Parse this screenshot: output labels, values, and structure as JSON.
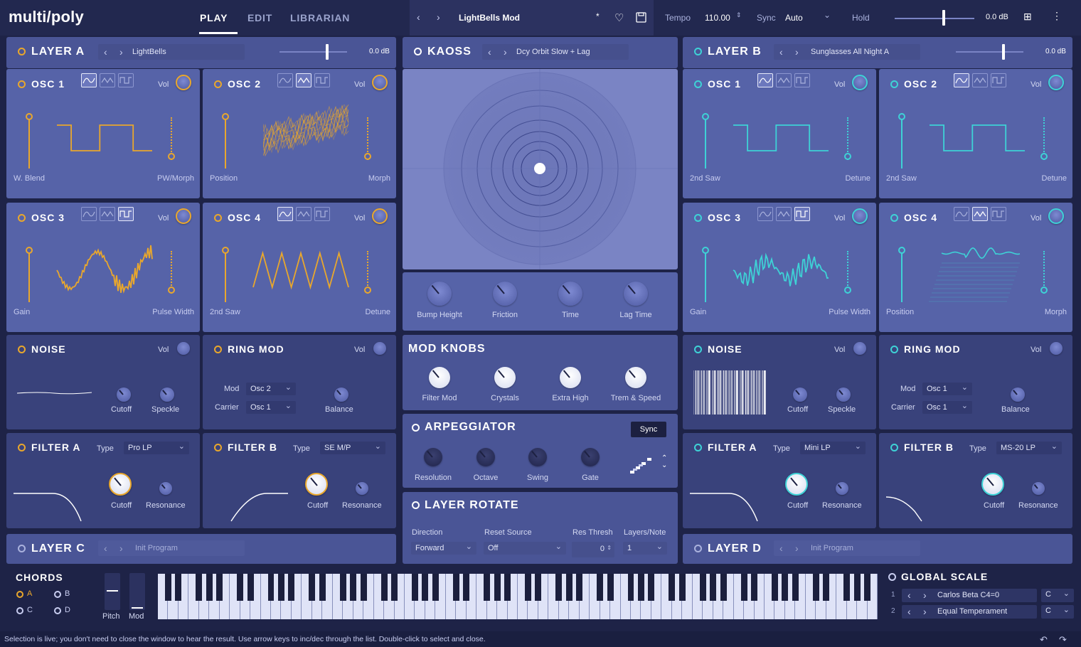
{
  "header": {
    "logo": "multi/poly",
    "tabs": [
      "PLAY",
      "EDIT",
      "LIBRARIAN"
    ],
    "preset_name": "LightBells Mod",
    "modified_mark": "*",
    "tempo_label": "Tempo",
    "tempo_value": "110.00",
    "sync_label": "Sync",
    "sync_value": "Auto",
    "hold_label": "Hold",
    "volume_db": "0.0 dB"
  },
  "layers": {
    "a": {
      "title": "LAYER A",
      "preset": "LightBells",
      "db": "0.0 dB"
    },
    "b": {
      "title": "LAYER B",
      "preset": "Sunglasses All Night A",
      "db": "0.0 dB"
    },
    "c": {
      "title": "LAYER C",
      "preset": "Init Program"
    },
    "d": {
      "title": "LAYER D",
      "preset": "Init Program"
    }
  },
  "osc": {
    "a1": {
      "title": "OSC 1",
      "vol": "Vol",
      "left": "W. Blend",
      "right": "PW/Morph"
    },
    "a2": {
      "title": "OSC 2",
      "vol": "Vol",
      "left": "Position",
      "right": "Morph"
    },
    "a3": {
      "title": "OSC 3",
      "vol": "Vol",
      "left": "Gain",
      "right": "Pulse Width"
    },
    "a4": {
      "title": "OSC 4",
      "vol": "Vol",
      "left": "2nd Saw",
      "right": "Detune"
    },
    "b1": {
      "title": "OSC 1",
      "vol": "Vol",
      "left": "2nd Saw",
      "right": "Detune"
    },
    "b2": {
      "title": "OSC 2",
      "vol": "Vol",
      "left": "2nd Saw",
      "right": "Detune"
    },
    "b3": {
      "title": "OSC 3",
      "vol": "Vol",
      "left": "Gain",
      "right": "Pulse Width"
    },
    "b4": {
      "title": "OSC 4",
      "vol": "Vol",
      "left": "Position",
      "right": "Morph"
    }
  },
  "noise": {
    "title": "NOISE",
    "vol": "Vol",
    "cutoff": "Cutoff",
    "speckle": "Speckle"
  },
  "ringmod": {
    "title": "RING MOD",
    "vol": "Vol",
    "mod_label": "Mod",
    "mod_value": "Osc 2",
    "carrier_label": "Carrier",
    "carrier_value": "Osc 1",
    "balance": "Balance"
  },
  "ringmod_b": {
    "mod_value": "Osc 1",
    "carrier_value": "Osc 1"
  },
  "filters": {
    "aa": {
      "title": "FILTER A",
      "type_label": "Type",
      "type": "Pro LP",
      "cutoff": "Cutoff",
      "resonance": "Resonance"
    },
    "ab": {
      "title": "FILTER B",
      "type_label": "Type",
      "type": "SE M/P",
      "cutoff": "Cutoff",
      "resonance": "Resonance"
    },
    "ba": {
      "title": "FILTER A",
      "type_label": "Type",
      "type": "Mini LP",
      "cutoff": "Cutoff",
      "resonance": "Resonance"
    },
    "bb": {
      "title": "FILTER B",
      "type_label": "Type",
      "type": "MS-20 LP",
      "cutoff": "Cutoff",
      "resonance": "Resonance"
    }
  },
  "kaoss": {
    "title": "KAOSS",
    "preset": "Dcy Orbit Slow + Lag",
    "knobs": [
      "Bump Height",
      "Friction",
      "Time",
      "Lag Time"
    ]
  },
  "mod_knobs": {
    "title": "MOD KNOBS",
    "knobs": [
      "Filter Mod",
      "Crystals",
      "Extra High",
      "Trem & Speed"
    ]
  },
  "arp": {
    "title": "ARPEGGIATOR",
    "sync": "Sync",
    "knobs": [
      "Resolution",
      "Octave",
      "Swing",
      "Gate"
    ]
  },
  "rotate": {
    "title": "LAYER ROTATE",
    "direction_label": "Direction",
    "direction": "Forward",
    "reset_label": "Reset Source",
    "reset": "Off",
    "res_label": "Res Thresh",
    "res": "0",
    "layers_label": "Layers/Note",
    "layers": "1"
  },
  "chords": {
    "title": "CHORDS",
    "items": [
      "A",
      "B",
      "C",
      "D"
    ]
  },
  "wheels": {
    "pitch": "Pitch",
    "mod": "Mod"
  },
  "scale": {
    "title": "GLOBAL SCALE",
    "rows": [
      {
        "num": "1",
        "name": "Carlos Beta C4=0",
        "key": "C"
      },
      {
        "num": "2",
        "name": "Equal Temperament",
        "key": "C"
      }
    ]
  },
  "status": "Selection is live; you don't need to close the window to hear the result. Use arrow keys to inc/dec through the list. Double-click to select and close.",
  "colors": {
    "accent_orange": "#e9a72c",
    "accent_teal": "#3ed2d6",
    "panel": "#5663a8",
    "background": "#1e2347"
  }
}
